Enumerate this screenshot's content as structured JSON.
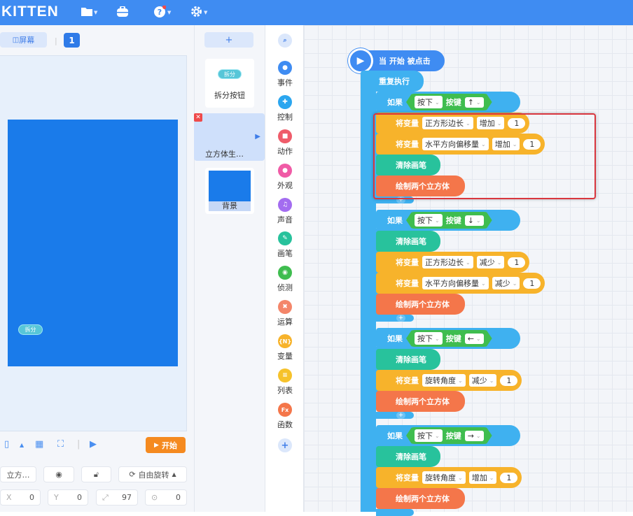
{
  "topbar": {
    "logo": "KITTEN"
  },
  "stage": {
    "screen_button": "屏幕",
    "page_number": "1",
    "mini_button_label": "拆分",
    "start_button": "开始",
    "sprite_name": "立方…",
    "rotation_mode": "自由旋转",
    "x_label": "X",
    "x_value": "0",
    "y_label": "Y",
    "y_value": "0",
    "size_value": "97",
    "direction_value": "0"
  },
  "sprites": {
    "add_label": "+",
    "items": [
      {
        "name": "拆分按钮",
        "button_text": "拆分"
      },
      {
        "name": "立方体生…"
      },
      {
        "name": "背景"
      }
    ]
  },
  "categories": [
    {
      "label": "事件",
      "color": "#3f8cf2"
    },
    {
      "label": "控制",
      "color": "#2ba6ef"
    },
    {
      "label": "动作",
      "color": "#ef5c6a"
    },
    {
      "label": "外观",
      "color": "#f05ba6"
    },
    {
      "label": "声音",
      "color": "#a36cf0"
    },
    {
      "label": "画笔",
      "color": "#28c29c"
    },
    {
      "label": "侦测",
      "color": "#3fbd4f"
    },
    {
      "label": "运算",
      "color": "#f4866a"
    },
    {
      "label": "变量",
      "color": "#f7b32b"
    },
    {
      "label": "列表",
      "color": "#f6c22b"
    },
    {
      "label": "函数",
      "color": "#f4764a"
    }
  ],
  "code": {
    "hat": "当 开始 被点击",
    "repeat": "重复执行",
    "if_label": "如果",
    "press": "按下",
    "key": "按键",
    "set_var": "将变量",
    "clear_pen": "清除画笔",
    "draw": "绘制两个立方体",
    "groups": [
      {
        "arrow": "↑",
        "lines": [
          {
            "var": "正方形边长",
            "op": "增加",
            "val": "1"
          },
          {
            "var": "水平方向偏移量",
            "op": "增加",
            "val": "1"
          }
        ]
      },
      {
        "arrow": "↓",
        "lines": [
          {
            "var": "正方形边长",
            "op": "减少",
            "val": "1"
          },
          {
            "var": "水平方向偏移量",
            "op": "减少",
            "val": "1"
          }
        ]
      },
      {
        "arrow": "←",
        "lines": [
          {
            "var": "旋转角度",
            "op": "减少",
            "val": "1"
          }
        ]
      },
      {
        "arrow": "→",
        "lines": [
          {
            "var": "旋转角度",
            "op": "增加",
            "val": "1"
          }
        ]
      }
    ]
  },
  "colors": {
    "accent": "#3f8cf2",
    "control": "#3fb1f0",
    "sensing": "#3fbd4f",
    "variable": "#f7b32b",
    "pen": "#28c29c",
    "function": "#f4764a",
    "highlight": "#d9363e"
  }
}
